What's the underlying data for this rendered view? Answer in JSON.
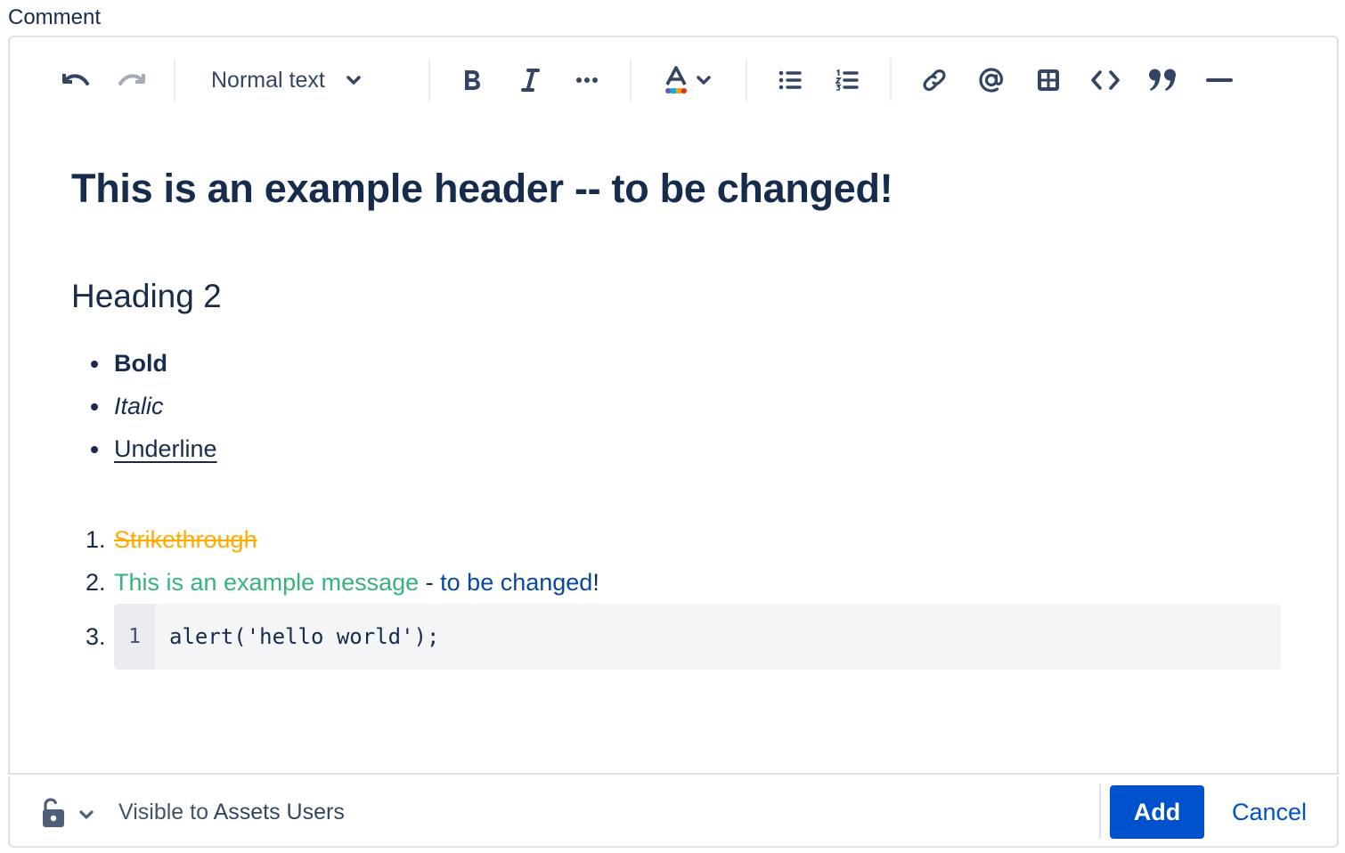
{
  "field": {
    "label": "Comment"
  },
  "toolbar": {
    "undo_icon": "undo-icon",
    "redo_icon": "redo-icon",
    "text_style": "Normal text",
    "buttons": [
      "bold-icon",
      "italic-icon",
      "more-formatting-icon",
      "text-color-icon",
      "bullet-list-icon",
      "numbered-list-icon",
      "link-icon",
      "mention-icon",
      "table-icon",
      "code-icon",
      "quote-icon",
      "divider-icon"
    ],
    "text_color_swatches": [
      "#6554c0",
      "#00b8d9",
      "#ff991f",
      "#de350b"
    ]
  },
  "content": {
    "heading1": "This is an example header -- to be changed!",
    "heading2": "Heading 2",
    "bullets": [
      {
        "text": "Bold",
        "style": "bold"
      },
      {
        "text": "Italic",
        "style": "italic"
      },
      {
        "text": "Underline",
        "style": "underline"
      }
    ],
    "numbered": {
      "item1": {
        "number": "1.",
        "text": "Strikethrough",
        "color": "#ffab00"
      },
      "item2": {
        "number": "2.",
        "part1": "This is an example message",
        "part1_color": "#36b37e",
        "part2": " - ",
        "part3": "to be changed",
        "part3_color": "#0747a6",
        "part4": "!"
      },
      "item3": {
        "number": "3.",
        "code_line_number": "1",
        "code": "alert('hello world');"
      }
    }
  },
  "footer": {
    "visibility_prefix": "Visible to ",
    "visibility_group": "Assets Users",
    "add_label": "Add",
    "cancel_label": "Cancel",
    "primary_color": "#0052cc"
  }
}
